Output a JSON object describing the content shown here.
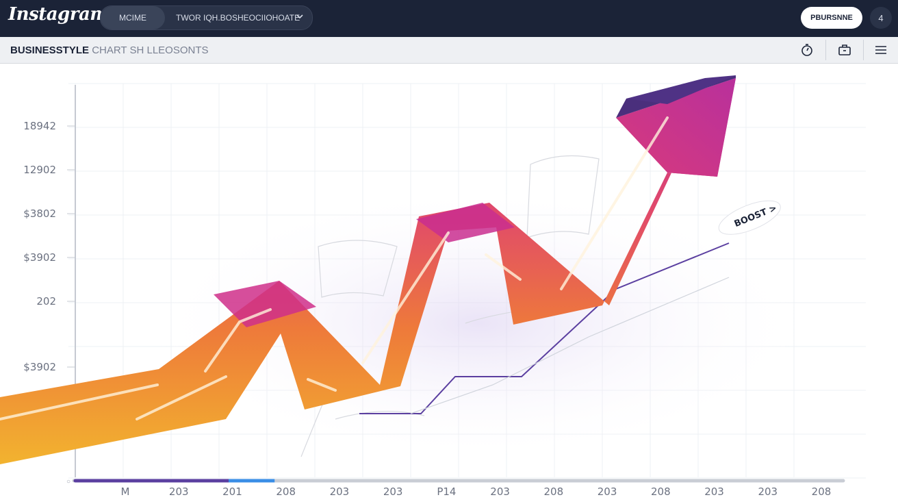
{
  "header": {
    "logo": "Instagram",
    "home_tab": "MCIME",
    "dropdown_value": "TWOR IQH.BOSHEOCIIOHOATE",
    "action_button": "PBURSNNE",
    "badge_count": "4"
  },
  "subheader": {
    "title_bold": "BUSINESSTYLE",
    "title_rest": " CHART SH LLEOSONTS"
  },
  "icons": {
    "logo_icon": "instagram-wordmark",
    "dropdown_icon": "chevron-down-icon",
    "tool_1": "stopwatch-icon",
    "tool_2": "briefcase-icon",
    "tool_3": "menu-icon"
  },
  "colors": {
    "navy": "#1b2337",
    "arrow_orange": "#f0a030",
    "arrow_red": "#e94e5a",
    "arrow_magenta": "#c9338f",
    "arrow_purple": "#4a2f7c",
    "trend_line": "#5b3fa0",
    "progress_blue": "#3a8ee6"
  },
  "chart_data": {
    "type": "area",
    "y_ticks": [
      "18942",
      "12902",
      "$3802",
      "$3902",
      "202",
      "$3902"
    ],
    "x_ticks": [
      "M",
      "203",
      "201",
      "208",
      "203",
      "203",
      "P14",
      "203",
      "208",
      "203",
      "208",
      "203",
      "203",
      "208"
    ],
    "arrow_path": [
      {
        "x": 0,
        "y": 0.1
      },
      {
        "x": 1,
        "y": 0.2
      },
      {
        "x": 2,
        "y": 0.5
      },
      {
        "x": 3,
        "y": 0.25
      },
      {
        "x": 4,
        "y": 0.63
      },
      {
        "x": 5,
        "y": 0.4
      },
      {
        "x": 6,
        "y": 1.0
      }
    ],
    "annotation": "BOOST >",
    "progress": {
      "purple": 0.2,
      "blue": 0.06
    }
  }
}
